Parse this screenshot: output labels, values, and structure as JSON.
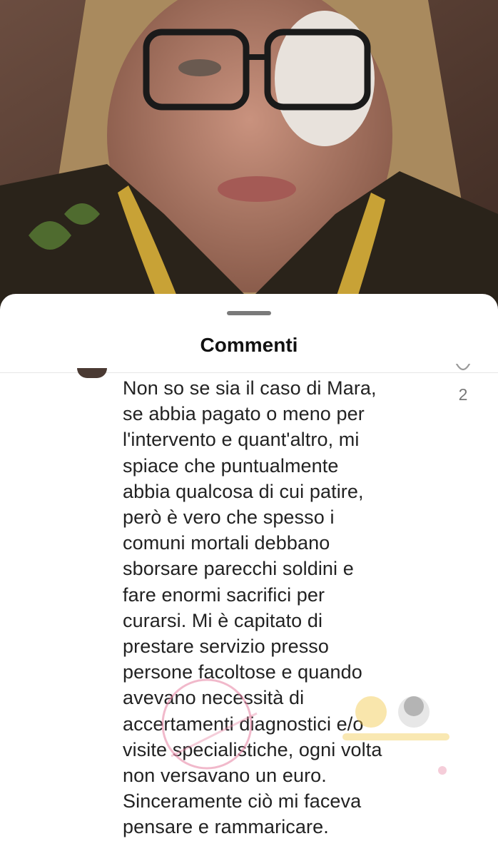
{
  "sheet": {
    "title": "Commenti"
  },
  "comment": {
    "lines": [
      "Non so se sia il caso di Mara,",
      "se abbia pagato o meno per",
      "l'intervento e quant'altro, mi",
      "spiace che puntualmente",
      "abbia qualcosa di cui patire,",
      "però è vero che spesso i",
      "comuni mortali debbano",
      "sborsare parecchi soldini e",
      "fare enormi sacrifici per",
      "curarsi. Mi è capitato di",
      "prestare servizio presso",
      "persone facoltose e quando",
      "avevano necessità di",
      "accertamenti diagnostici e/o",
      "visite specialistiche, ogni volta",
      "non versavano un euro.",
      "Sinceramente ciò mi faceva",
      "pensare e rammaricare."
    ],
    "like_count": "2",
    "like_icon": "heart-icon"
  },
  "photo": {
    "icon": "post-photo"
  },
  "colors": {
    "sheet_bg": "#ffffff",
    "text": "#222222",
    "muted": "#777777",
    "watermark_pink": "#e88aa8",
    "watermark_yellow": "#f2c94c"
  }
}
